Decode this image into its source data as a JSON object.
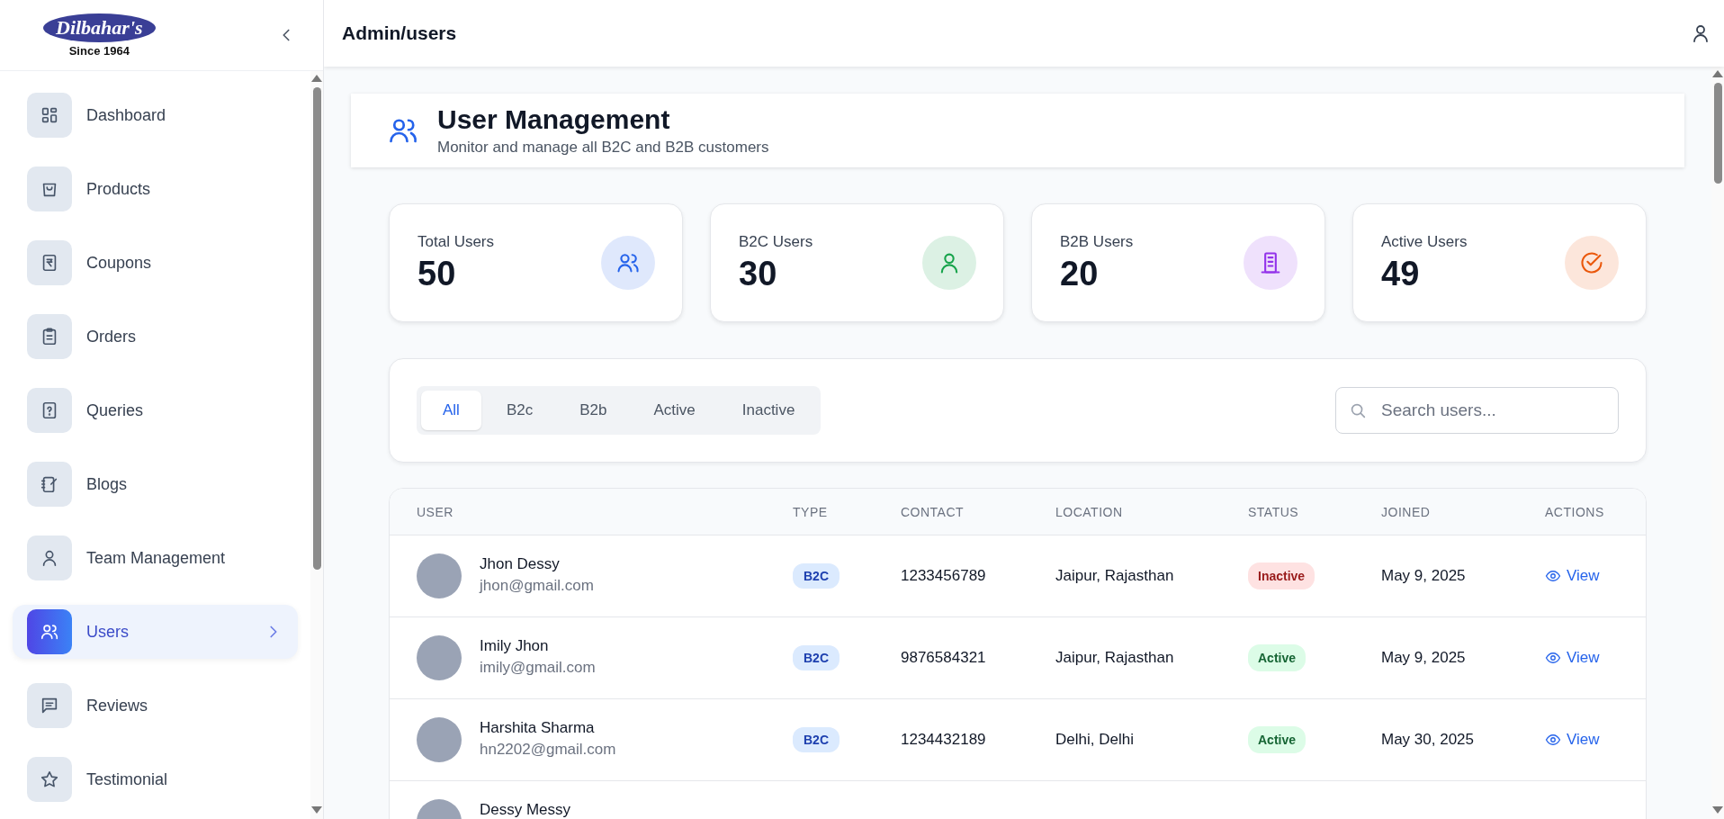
{
  "logo": {
    "brand": "Dilbahar's",
    "tagline": "Since 1964"
  },
  "sidebar": {
    "items": [
      {
        "label": "Dashboard",
        "selected": false
      },
      {
        "label": "Products",
        "selected": false
      },
      {
        "label": "Coupons",
        "selected": false
      },
      {
        "label": "Orders",
        "selected": false
      },
      {
        "label": "Queries",
        "selected": false
      },
      {
        "label": "Blogs",
        "selected": false
      },
      {
        "label": "Team Management",
        "selected": false
      },
      {
        "label": "Users",
        "selected": true
      },
      {
        "label": "Reviews",
        "selected": false
      },
      {
        "label": "Testimonial",
        "selected": false
      }
    ]
  },
  "header": {
    "title": "Admin/users"
  },
  "page": {
    "title": "User Management",
    "subtitle": "Monitor and manage all B2C and B2B customers"
  },
  "stats": [
    {
      "label": "Total Users",
      "value": "50",
      "color": "#2563eb"
    },
    {
      "label": "B2C Users",
      "value": "30",
      "color": "#16a34a"
    },
    {
      "label": "B2B Users",
      "value": "20",
      "color": "#9333ea"
    },
    {
      "label": "Active Users",
      "value": "49",
      "color": "#ea580c"
    }
  ],
  "filters": {
    "tabs": [
      {
        "label": "All",
        "selected": true
      },
      {
        "label": "B2c",
        "selected": false
      },
      {
        "label": "B2b",
        "selected": false
      },
      {
        "label": "Active",
        "selected": false
      },
      {
        "label": "Inactive",
        "selected": false
      }
    ],
    "search": {
      "placeholder": "Search users..."
    }
  },
  "table": {
    "columns": [
      "USER",
      "TYPE",
      "CONTACT",
      "LOCATION",
      "STATUS",
      "JOINED",
      "ACTIONS"
    ],
    "rows": [
      {
        "name": "Jhon Dessy",
        "email": "jhon@gmail.com",
        "type": "B2C",
        "contact": "1233456789",
        "location": "Jaipur, Rajasthan",
        "status": "Inactive",
        "active": false,
        "joined": "May 9, 2025",
        "action": "View"
      },
      {
        "name": "Imily Jhon",
        "email": "imily@gmail.com",
        "type": "B2C",
        "contact": "9876584321",
        "location": "Jaipur, Rajasthan",
        "status": "Active",
        "active": true,
        "joined": "May 9, 2025",
        "action": "View"
      },
      {
        "name": "Harshita Sharma",
        "email": "hn2202@gmail.com",
        "type": "B2C",
        "contact": "1234432189",
        "location": "Delhi, Delhi",
        "status": "Active",
        "active": true,
        "joined": "May 30, 2025",
        "action": "View"
      },
      {
        "name": "Dessy Messy"
      }
    ]
  }
}
